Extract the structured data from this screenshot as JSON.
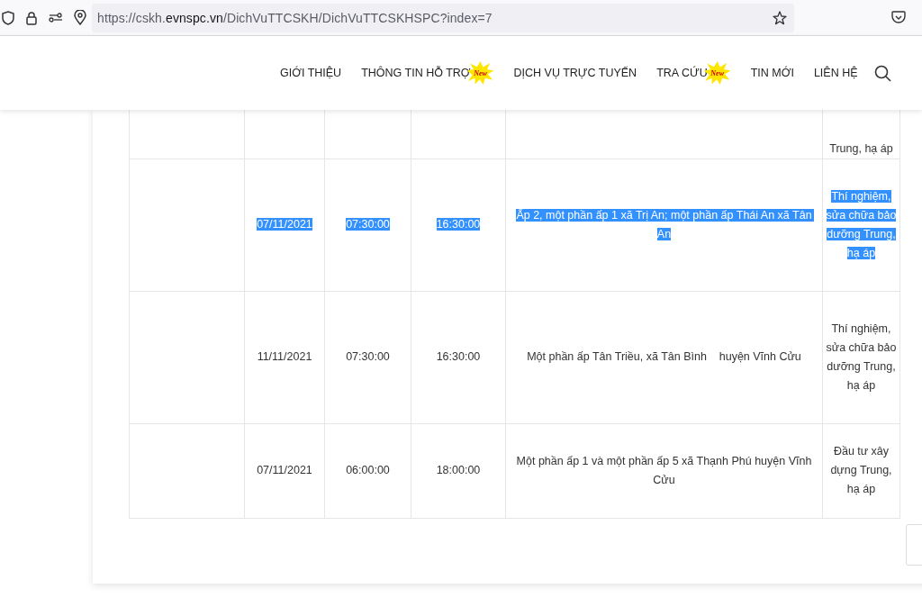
{
  "browser": {
    "url_prefix": "https://cskh.",
    "url_domain": "evnspc.vn",
    "url_path": "/DichVuTTCSKH/DichVuTTCSKHSPC?index=7"
  },
  "nav": [
    {
      "label": "GIỚI THIỆU"
    },
    {
      "label": "THÔNG TIN HỖ TRỢ",
      "badge": "New"
    },
    {
      "label": "DỊCH VỤ TRỰC TUYẾN"
    },
    {
      "label": "TRA CỨU",
      "badge": "New"
    },
    {
      "label": "TIN MỚI"
    },
    {
      "label": "LIÊN HỆ"
    }
  ],
  "table": {
    "rows": [
      {
        "cut": true,
        "text_selected": false,
        "cells": [
          "",
          "",
          "",
          "",
          "",
          "Trung, hạ áp"
        ]
      },
      {
        "cut": false,
        "text_selected": true,
        "cells": [
          "",
          "07/11/2021",
          "07:30:00",
          "16:30:00",
          "Ấp 2, một phần ấp 1 xã Trị An; một phần ấp Thái An xã Tân An",
          "Thí nghiệm, sửa chữa bảo dưỡng Trung, hạ áp"
        ]
      },
      {
        "cut": false,
        "text_selected": false,
        "cells": [
          "",
          "11/11/2021",
          "07:30:00",
          "16:30:00",
          "Một phần ấp Tân Triều, xã Tân Bình    huyện Vĩnh Cửu",
          "Thí nghiệm, sửa chữa bảo dưỡng Trung, hạ áp"
        ]
      },
      {
        "cut": false,
        "text_selected": false,
        "cells": [
          "",
          "07/11/2021",
          "06:00:00",
          "18:00:00",
          "Một phần ấp 1 và một phần ấp 5 xã Thạnh Phú huyện Vĩnh Cửu",
          "Đầu tư xây dựng Trung, hạ áp"
        ]
      }
    ]
  }
}
